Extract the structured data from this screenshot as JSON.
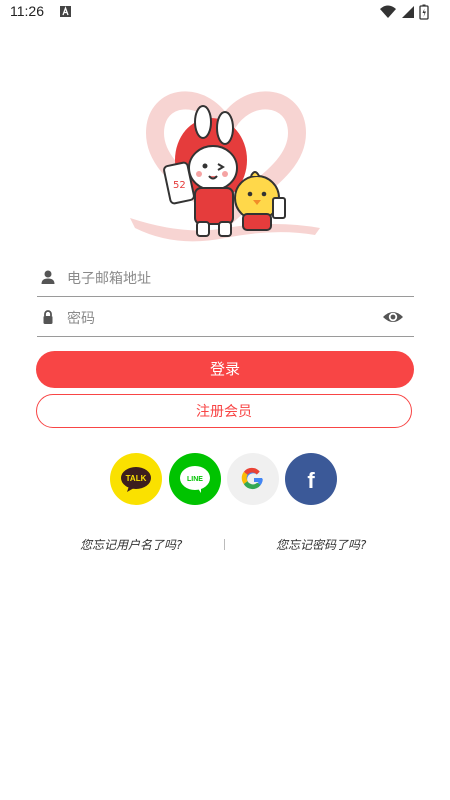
{
  "status_bar": {
    "time": "11:26",
    "icons": [
      "app-a-icon",
      "wifi-icon",
      "cell-signal-icon",
      "battery-icon"
    ]
  },
  "hero": {
    "character_badge": "52"
  },
  "login_form": {
    "email_placeholder": "电子邮箱地址",
    "password_placeholder": "密码",
    "login_label": "登录",
    "register_label": "注册会员"
  },
  "social": {
    "kakao_label": "TALK",
    "line_label": "LINE",
    "google_label": "G",
    "facebook_label": "f"
  },
  "links": {
    "forgot_username": "您忘记用户名了吗?",
    "forgot_password": "您忘记密码了吗?"
  },
  "colors": {
    "accent": "#f84545",
    "kakao": "#fae100",
    "line": "#00c300",
    "facebook": "#3b5998"
  }
}
